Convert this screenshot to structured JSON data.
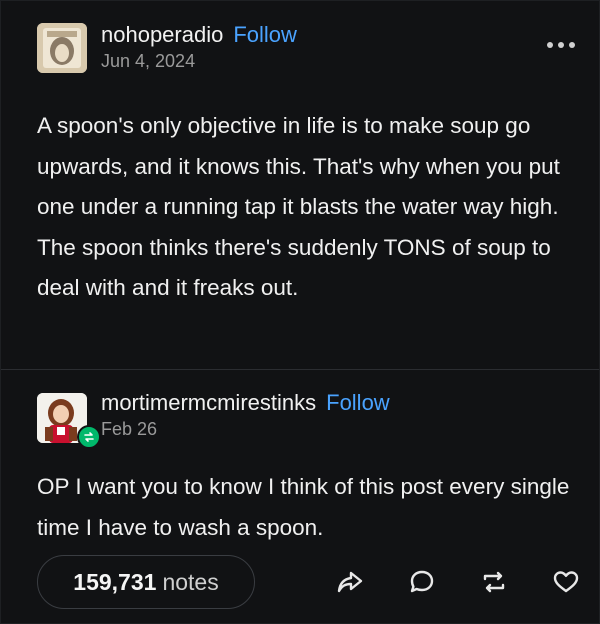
{
  "post": {
    "author": "nohoperadio",
    "follow_label": "Follow",
    "date": "Jun 4, 2024",
    "more_icon": "more-horizontal-icon",
    "body": "A spoon's only objective in life is to make soup go upwards, and it knows this. That's why when you put one under a running tap it blasts the water way high. The spoon thinks there's suddenly TONS of soup to deal with and it freaks out."
  },
  "reblog": {
    "author": "mortimermcmirestinks",
    "follow_label": "Follow",
    "date": "Feb 26",
    "badge_icon": "reblog-badge-icon",
    "body": "OP I want you to know I think of this post every single time I have to wash a spoon."
  },
  "footer": {
    "notes_count": "159,731",
    "notes_label": "notes",
    "actions": [
      "share-icon",
      "reply-icon",
      "reblog-icon",
      "like-icon"
    ]
  },
  "colors": {
    "background": "#111214",
    "link": "#4aa3ff",
    "text": "#f0f0f0",
    "muted": "#9a9a9a",
    "reblog_green": "#00b86b"
  }
}
